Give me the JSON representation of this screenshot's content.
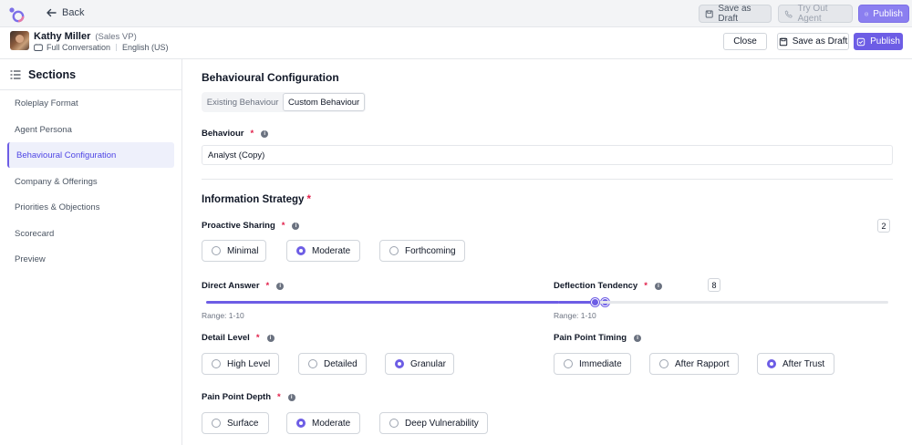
{
  "topbar": {
    "back_label": "Back",
    "save_draft_label": "Save as Draft",
    "try_agent_label": "Try Out Agent",
    "publish_label": "Publish"
  },
  "header": {
    "name": "Kathy Miller",
    "role": "(Sales VP)",
    "mode": "Full Conversation",
    "language": "English (US)",
    "close_label": "Close",
    "save_draft_label": "Save as Draft",
    "publish_label": "Publish"
  },
  "sidebar": {
    "title": "Sections",
    "items": [
      {
        "label": "Roleplay Format"
      },
      {
        "label": "Agent Persona"
      },
      {
        "label": "Behavioural Configuration"
      },
      {
        "label": "Company & Offerings"
      },
      {
        "label": "Priorities & Objections"
      },
      {
        "label": "Scorecard"
      },
      {
        "label": "Preview"
      }
    ],
    "active": "Behavioural Configuration"
  },
  "main": {
    "title": "Behavioural Configuration",
    "tabs": [
      {
        "label": "Existing Behaviour",
        "selected": false
      },
      {
        "label": "Custom Behaviour",
        "selected": true
      }
    ],
    "behaviour_label": "Behaviour",
    "behaviour_value": "Analyst (Copy)",
    "strategy_title": "Information Strategy",
    "proactive_sharing": {
      "label": "Proactive Sharing",
      "options": [
        "Minimal",
        "Moderate",
        "Forthcoming"
      ],
      "selected": "Moderate"
    },
    "direct_answer": {
      "label": "Direct Answer",
      "value": 8,
      "value_text": "8",
      "range_text": "Range: 1-10",
      "min": 1,
      "max": 10
    },
    "deflection_tendency": {
      "label": "Deflection Tendency",
      "value": 2,
      "value_text": "2",
      "range_text": "Range: 1-10",
      "min": 1,
      "max": 10
    },
    "detail_level": {
      "label": "Detail Level",
      "options": [
        "High Level",
        "Detailed",
        "Granular"
      ],
      "selected": "Granular"
    },
    "pain_point_timing": {
      "label": "Pain Point Timing",
      "options": [
        "Immediate",
        "After Rapport",
        "After Trust"
      ],
      "selected": "After Trust"
    },
    "pain_point_depth": {
      "label": "Pain Point Depth",
      "options": [
        "Surface",
        "Moderate",
        "Deep Vulnerability"
      ],
      "selected": "Moderate"
    }
  },
  "colors": {
    "accent": "#6d5de5",
    "required": "#e11d48"
  }
}
